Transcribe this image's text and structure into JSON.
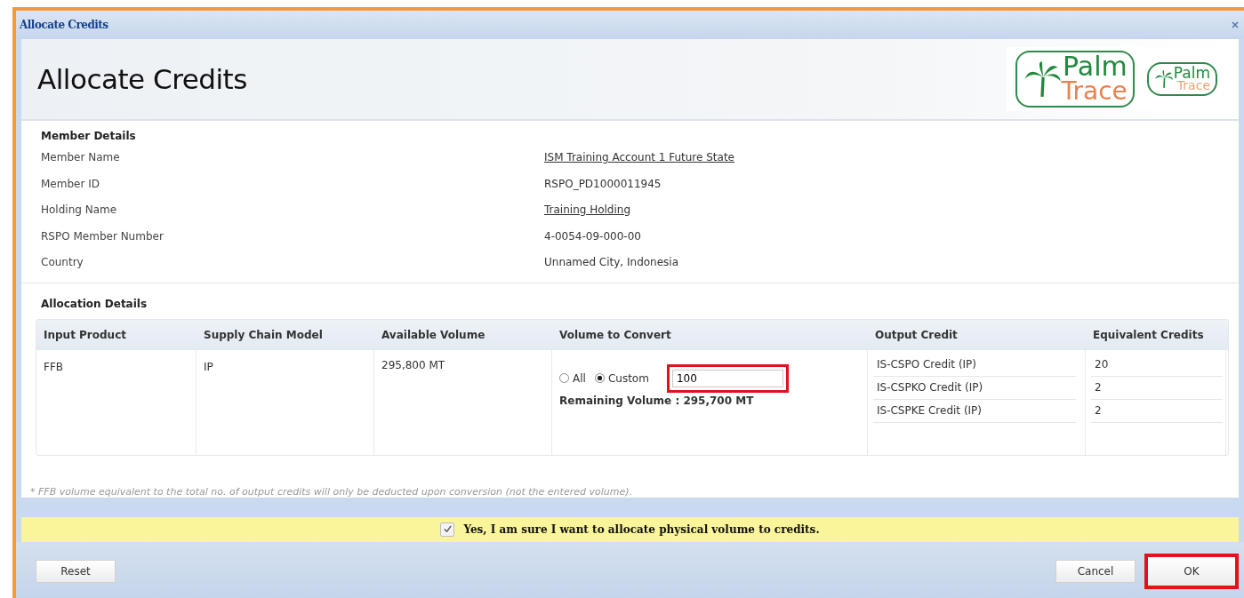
{
  "window": {
    "title": "Allocate Credits"
  },
  "header": {
    "title": "Allocate Credits",
    "logos": [
      {
        "top": "Palm",
        "bottom": "Trace"
      },
      {
        "top": "Palm",
        "bottom": "Trace"
      }
    ]
  },
  "member_details": {
    "heading": "Member Details",
    "fields": [
      {
        "label": "Member Name",
        "value": "ISM Training Account 1 Future State",
        "kind": "link"
      },
      {
        "label": "Member ID",
        "value": "RSPO_PD1000011945",
        "kind": "text"
      },
      {
        "label": "Holding Name",
        "value": "Training Holding",
        "kind": "link"
      },
      {
        "label": "RSPO Member Number",
        "value": "4-0054-09-000-00",
        "kind": "text"
      },
      {
        "label": "Country",
        "value": "Unnamed City, Indonesia",
        "kind": "text"
      }
    ]
  },
  "allocation_details": {
    "heading": "Allocation Details",
    "columns": [
      "Input Product",
      "Supply Chain Model",
      "Available Volume",
      "Volume to Convert",
      "Output Credit",
      "Equivalent Credits"
    ],
    "row": {
      "input_product": "FFB",
      "supply_chain_model": "IP",
      "available_volume": "295,800 MT",
      "volume_options": [
        {
          "label": "All",
          "selected": false
        },
        {
          "label": "Custom",
          "selected": true
        }
      ],
      "custom_volume": {
        "value": "100",
        "highlighted": true
      },
      "remaining_volume": "Remaining Volume : 295,700 MT",
      "credits": [
        {
          "output": "IS-CSPO Credit (IP)",
          "equivalent": "20"
        },
        {
          "output": "IS-CSPKO Credit (IP)",
          "equivalent": "2"
        },
        {
          "output": "IS-CSPKE Credit (IP)",
          "equivalent": "2"
        }
      ]
    }
  },
  "footnote": "* FFB volume equivalent to the total no. of output credits will only be deducted upon conversion (not the entered volume).",
  "confirmation": {
    "label": "Yes, I am sure I want to allocate physical volume to credits.",
    "checked": true
  },
  "buttons": [
    {
      "label": "Reset",
      "highlighted": false
    },
    {
      "label": "Cancel",
      "highlighted": false
    },
    {
      "label": "OK",
      "highlighted": true
    }
  ]
}
